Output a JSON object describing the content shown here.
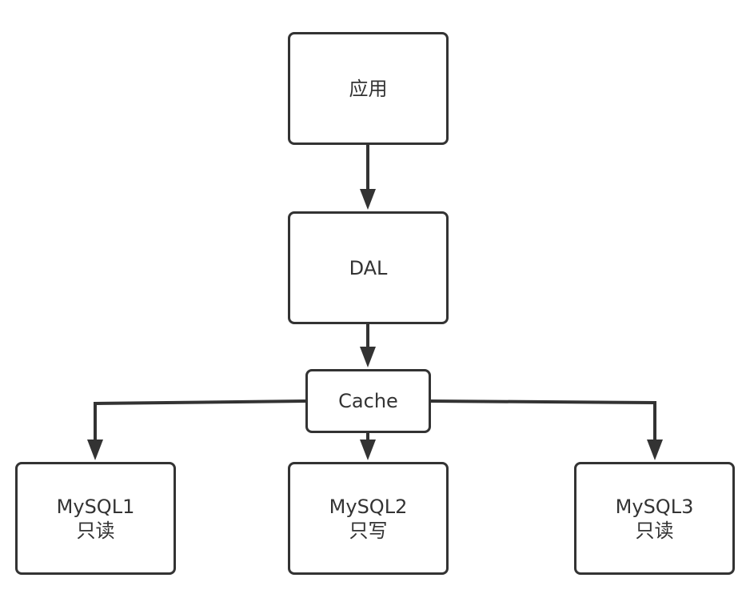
{
  "diagram": {
    "line_color": "#333333",
    "nodes": {
      "app": {
        "label": "应用"
      },
      "dal": {
        "label": "DAL"
      },
      "cache": {
        "label": "Cache"
      },
      "mysql1": {
        "name": "MySQL1",
        "role": "只读"
      },
      "mysql2": {
        "name": "MySQL2",
        "role": "只写"
      },
      "mysql3": {
        "name": "MySQL3",
        "role": "只读"
      }
    },
    "edges": [
      {
        "from": "app",
        "to": "dal"
      },
      {
        "from": "dal",
        "to": "cache"
      },
      {
        "from": "cache",
        "to": "mysql1"
      },
      {
        "from": "cache",
        "to": "mysql2"
      },
      {
        "from": "cache",
        "to": "mysql3"
      }
    ]
  }
}
